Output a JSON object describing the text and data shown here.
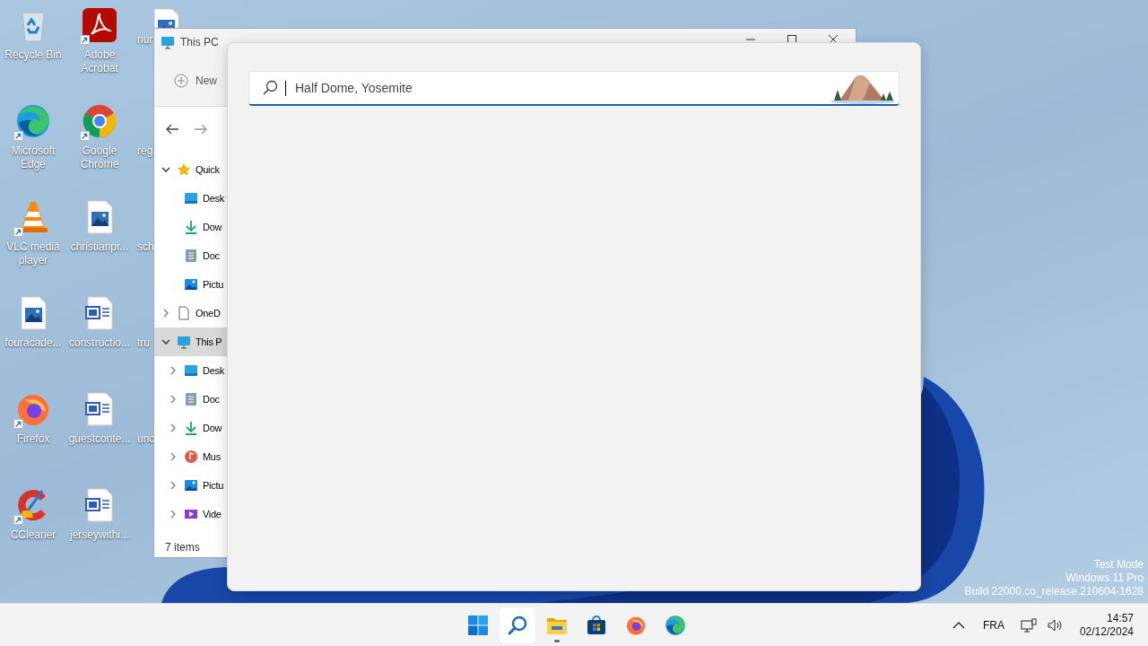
{
  "desktop_icons": [
    {
      "label": "Recycle Bin",
      "kind": "recycle",
      "shortcut": false
    },
    {
      "label": "Microsoft Edge",
      "kind": "edge",
      "shortcut": true
    },
    {
      "label": "VLC media player",
      "kind": "vlc",
      "shortcut": true
    },
    {
      "label": "fouracade...",
      "kind": "image",
      "shortcut": false
    },
    {
      "label": "Firefox",
      "kind": "firefox",
      "shortcut": true
    },
    {
      "label": "CCleaner",
      "kind": "ccleaner",
      "shortcut": true
    },
    {
      "label": "Adobe Acrobat",
      "kind": "acrobat",
      "shortcut": true
    },
    {
      "label": "Google Chrome",
      "kind": "chrome",
      "shortcut": true
    },
    {
      "label": "christianpr...",
      "kind": "image",
      "shortcut": false
    },
    {
      "label": "constructio...",
      "kind": "word",
      "shortcut": false
    },
    {
      "label": "guestconte...",
      "kind": "word",
      "shortcut": false
    },
    {
      "label": "jerseywithi...",
      "kind": "word",
      "shortcut": false
    },
    {
      "label": "nur",
      "kind": "image",
      "shortcut": false
    },
    {
      "label": "reg",
      "kind": "none"
    },
    {
      "label": "sch",
      "kind": "none"
    },
    {
      "label": "tru",
      "kind": "none"
    },
    {
      "label": "unc",
      "kind": "none"
    }
  ],
  "explorer": {
    "title": "This PC",
    "new_button": "New",
    "status": "7 items",
    "sidebar": [
      {
        "label": "Quick",
        "kind": "star",
        "expanded": true,
        "selected": false,
        "children": [
          {
            "label": "Desk",
            "kind": "desktop",
            "selected": false
          },
          {
            "label": "Dow",
            "kind": "download",
            "selected": false
          },
          {
            "label": "Doc",
            "kind": "document",
            "selected": false
          },
          {
            "label": "Pictu",
            "kind": "pictures",
            "selected": false
          }
        ]
      },
      {
        "label": "OneD",
        "kind": "file",
        "expanded": false,
        "selected": false
      },
      {
        "label": "This P",
        "kind": "pc",
        "expanded": true,
        "selected": true,
        "children": [
          {
            "label": "Desk",
            "kind": "desktop",
            "expanded": false,
            "selected": false
          },
          {
            "label": "Doc",
            "kind": "document",
            "expanded": false,
            "selected": false
          },
          {
            "label": "Dow",
            "kind": "download",
            "expanded": false,
            "selected": false
          },
          {
            "label": "Mus",
            "kind": "music",
            "expanded": false,
            "selected": false
          },
          {
            "label": "Pictu",
            "kind": "pictures",
            "expanded": false,
            "selected": false
          },
          {
            "label": "Vide",
            "kind": "videos",
            "expanded": false,
            "selected": false
          }
        ]
      }
    ]
  },
  "search_panel": {
    "placeholder": "Half Dome, Yosemite"
  },
  "watermark": [
    "Test Mode",
    "Windows 11 Pro",
    "Build 22000.co_release.210604-1628"
  ],
  "taskbar": {
    "apps": [
      {
        "kind": "start",
        "selected": false,
        "running": false
      },
      {
        "kind": "search",
        "selected": true,
        "running": false
      },
      {
        "kind": "explorer",
        "selected": false,
        "running": true
      },
      {
        "kind": "store",
        "selected": false,
        "running": false
      },
      {
        "kind": "firefox",
        "selected": false,
        "running": false
      },
      {
        "kind": "edge",
        "selected": false,
        "running": false
      }
    ],
    "language": "FRA",
    "time": "14:57",
    "date": "02/12/2024"
  }
}
